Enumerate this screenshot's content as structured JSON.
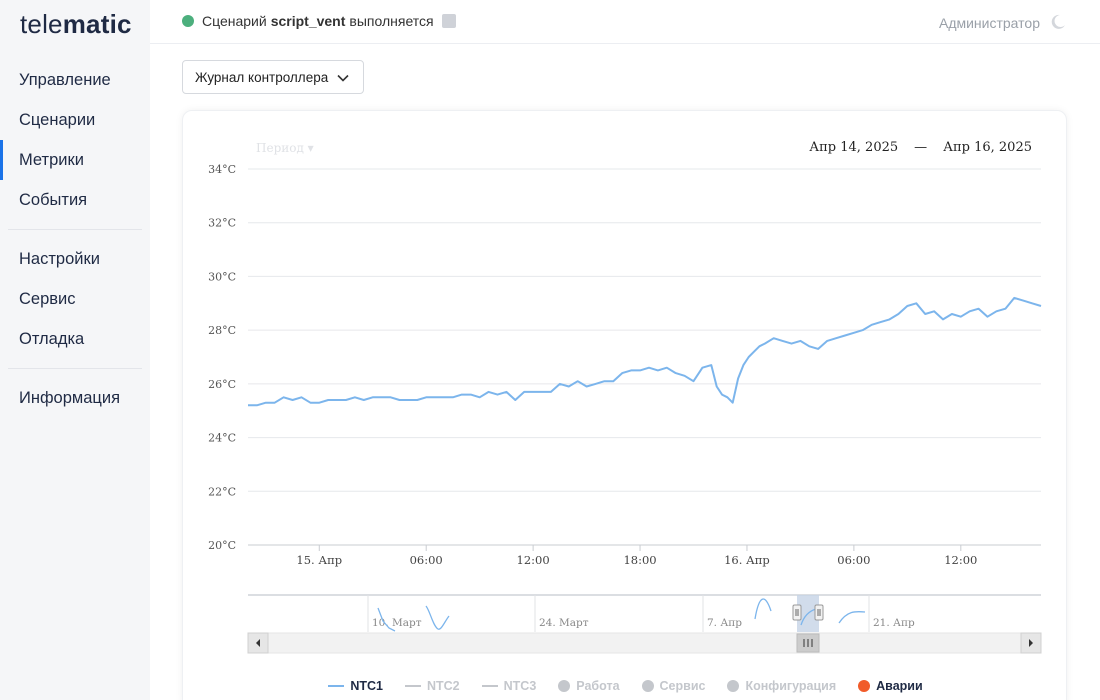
{
  "app": {
    "logo_light": "tele",
    "logo_bold": "matic"
  },
  "sidebar": {
    "groups": [
      [
        "Управление",
        "Сценарии",
        "Метрики",
        "События"
      ],
      [
        "Настройки",
        "Сервис",
        "Отладка"
      ],
      [
        "Информация"
      ]
    ],
    "active": "Метрики"
  },
  "topbar": {
    "status_prefix": "Сценарий",
    "status_script": "script_vent",
    "status_suffix": "выполняется",
    "status_color": "#4caf7d",
    "user": "Администратор",
    "theme_icon": "moon-icon"
  },
  "toolbar": {
    "dropdown_value": "Журнал контроллера"
  },
  "chart_panel": {
    "period_label": "Период ▾",
    "date_from": "Апр 14, 2025",
    "date_sep": "—",
    "date_to": "Апр 16, 2025"
  },
  "navigator": {
    "labels": [
      "10. Март",
      "24. Март",
      "7. Апр",
      "21. Апр"
    ]
  },
  "legend": [
    {
      "label": "NTC1",
      "kind": "line",
      "color": "#7cb5ec",
      "active": true
    },
    {
      "label": "NTC2",
      "kind": "line",
      "color": "#c4c7cc",
      "active": false
    },
    {
      "label": "NTC3",
      "kind": "line",
      "color": "#c4c7cc",
      "active": false
    },
    {
      "label": "Работа",
      "kind": "dot",
      "color": "#c4c7cc",
      "active": false
    },
    {
      "label": "Сервис",
      "kind": "dot",
      "color": "#c4c7cc",
      "active": false
    },
    {
      "label": "Конфигурация",
      "kind": "dot",
      "color": "#c4c7cc",
      "active": false
    },
    {
      "label": "Аварии",
      "kind": "dot",
      "color": "#f15c2a",
      "active": true
    }
  ],
  "chart_data": {
    "type": "line",
    "ylim": [
      20,
      34
    ],
    "y_ticks": [
      "20°C",
      "22°C",
      "24°C",
      "26°C",
      "28°C",
      "30°C",
      "32°C",
      "34°C"
    ],
    "xlim_hours": [
      0,
      44.5
    ],
    "x_ticks": [
      {
        "t": 4,
        "label": "15. Апр"
      },
      {
        "t": 10,
        "label": "06:00"
      },
      {
        "t": 16,
        "label": "12:00"
      },
      {
        "t": 22,
        "label": "18:00"
      },
      {
        "t": 28,
        "label": "16. Апр"
      },
      {
        "t": 34,
        "label": "06:00"
      },
      {
        "t": 40,
        "label": "12:00"
      }
    ],
    "series": [
      {
        "name": "NTC1",
        "color": "#7cb5ec",
        "x": [
          0,
          0.5,
          1,
          1.5,
          2,
          2.5,
          3,
          3.5,
          4,
          4.5,
          5,
          5.5,
          6,
          6.5,
          7,
          7.5,
          8,
          8.5,
          9,
          9.5,
          10,
          10.5,
          11,
          11.5,
          12,
          12.5,
          13,
          13.5,
          14,
          14.5,
          15,
          15.5,
          16,
          16.5,
          17,
          17.5,
          18,
          18.5,
          19,
          19.5,
          20,
          20.5,
          21,
          21.5,
          22,
          22.5,
          23,
          23.5,
          24,
          24.5,
          25,
          25.5,
          26,
          26.3,
          26.6,
          26.9,
          27.2,
          27.5,
          27.8,
          28.1,
          28.4,
          28.7,
          29,
          29.5,
          30,
          30.5,
          31,
          31.5,
          32,
          32.5,
          33,
          33.5,
          34,
          34.5,
          35,
          35.5,
          36,
          36.5,
          37,
          37.5,
          38,
          38.5,
          39,
          39.5,
          40,
          40.5,
          41,
          41.5,
          42,
          42.5,
          43,
          43.5,
          44,
          44.5
        ],
        "values": [
          25.2,
          25.2,
          25.3,
          25.3,
          25.5,
          25.4,
          25.5,
          25.3,
          25.3,
          25.4,
          25.4,
          25.4,
          25.5,
          25.4,
          25.5,
          25.5,
          25.5,
          25.4,
          25.4,
          25.4,
          25.5,
          25.5,
          25.5,
          25.5,
          25.6,
          25.6,
          25.5,
          25.7,
          25.6,
          25.7,
          25.4,
          25.7,
          25.7,
          25.7,
          25.7,
          26.0,
          25.9,
          26.1,
          25.9,
          26.0,
          26.1,
          26.1,
          26.4,
          26.5,
          26.5,
          26.6,
          26.5,
          26.6,
          26.4,
          26.3,
          26.1,
          26.6,
          26.7,
          25.9,
          25.6,
          25.5,
          25.3,
          26.2,
          26.7,
          27.0,
          27.2,
          27.4,
          27.5,
          27.7,
          27.6,
          27.5,
          27.6,
          27.4,
          27.3,
          27.6,
          27.7,
          27.8,
          27.9,
          28.0,
          28.2,
          28.3,
          28.4,
          28.6,
          28.9,
          29.0,
          28.6,
          28.7,
          28.4,
          28.6,
          28.5,
          28.7,
          28.8,
          28.5,
          28.7,
          28.8,
          29.2,
          29.1,
          29.0,
          28.9
        ]
      }
    ]
  }
}
